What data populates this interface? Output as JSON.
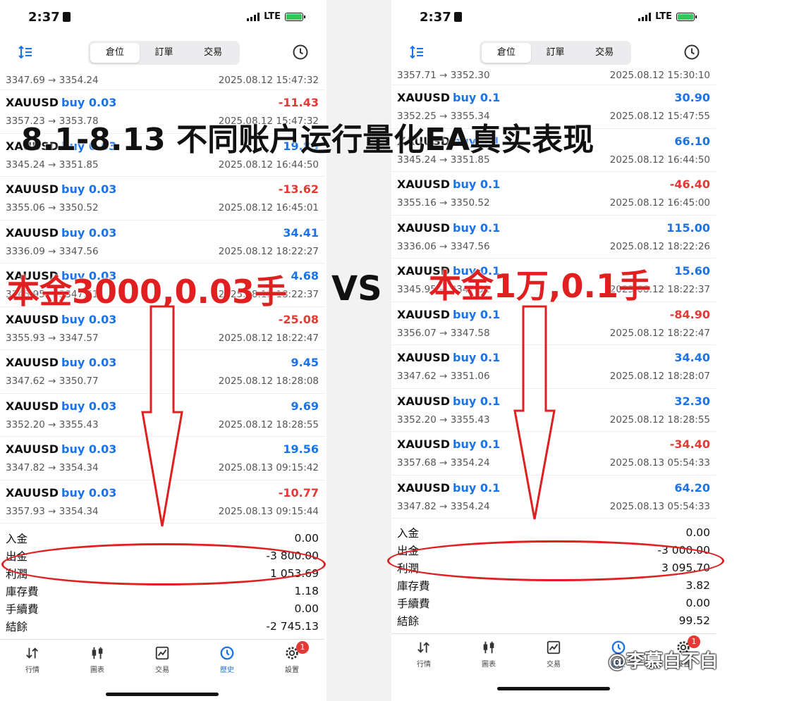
{
  "overlay": {
    "title": "8.1-8.13 不同账户运行量化EA真实表现",
    "left_label": "本金3000,0.03手",
    "vs": "VS",
    "right_label": "本金1万,0.1手",
    "watermark": "@李慕白不白"
  },
  "colors": {
    "accent_blue": "#1a73e8",
    "loss_red": "#e53935",
    "annotation_red": "#e02020",
    "battery_green": "#34c759"
  },
  "left": {
    "status_time": "2:37",
    "network": "LTE",
    "tabs": [
      "倉位",
      "訂單",
      "交易"
    ],
    "first_row": {
      "prices": "3347.69 → 3354.24",
      "date": "2025.08.12 15:47:32"
    },
    "trades": [
      {
        "symbol": "XAUUSD",
        "side": "buy 0.03",
        "profit": "-11.43",
        "prices": "3357.23 → 3353.78",
        "date": "2025.08.12 15:47:32"
      },
      {
        "symbol": "XAUUSD",
        "side": "buy 0.03",
        "profit": "19.83",
        "prices": "3345.24 → 3351.85",
        "date": "2025.08.12 16:44:50"
      },
      {
        "symbol": "XAUUSD",
        "side": "buy 0.03",
        "profit": "-13.62",
        "prices": "3355.06 → 3350.52",
        "date": "2025.08.12 16:45:01"
      },
      {
        "symbol": "XAUUSD",
        "side": "buy 0.03",
        "profit": "34.41",
        "prices": "3336.09 → 3347.56",
        "date": "2025.08.12 18:22:27"
      },
      {
        "symbol": "XAUUSD",
        "side": "buy 0.03",
        "profit": "4.68",
        "prices": "3345.95 → 3347.51",
        "date": "2025.08.12 18:22:37"
      },
      {
        "symbol": "XAUUSD",
        "side": "buy 0.03",
        "profit": "-25.08",
        "prices": "3355.93 → 3347.57",
        "date": "2025.08.12 18:22:47"
      },
      {
        "symbol": "XAUUSD",
        "side": "buy 0.03",
        "profit": "9.45",
        "prices": "3347.62 → 3350.77",
        "date": "2025.08.12 18:28:08"
      },
      {
        "symbol": "XAUUSD",
        "side": "buy 0.03",
        "profit": "9.69",
        "prices": "3352.20 → 3355.43",
        "date": "2025.08.12 18:28:55"
      },
      {
        "symbol": "XAUUSD",
        "side": "buy 0.03",
        "profit": "19.56",
        "prices": "3347.82 → 3354.34",
        "date": "2025.08.13 09:15:42"
      },
      {
        "symbol": "XAUUSD",
        "side": "buy 0.03",
        "profit": "-10.77",
        "prices": "3357.93 → 3354.34",
        "date": "2025.08.13 09:15:44"
      }
    ],
    "summary": [
      {
        "label": "入金",
        "value": "0.00"
      },
      {
        "label": "出金",
        "value": "-3 800.00"
      },
      {
        "label": "利潤",
        "value": "1 053.69"
      },
      {
        "label": "庫存費",
        "value": "1.18"
      },
      {
        "label": "手續費",
        "value": "0.00"
      },
      {
        "label": "結餘",
        "value": "-2 745.13"
      }
    ],
    "nav": [
      {
        "label": "行情",
        "icon": "trend-arrows-icon"
      },
      {
        "label": "圖表",
        "icon": "candlestick-icon"
      },
      {
        "label": "交易",
        "icon": "trade-chart-icon"
      },
      {
        "label": "歷史",
        "icon": "history-icon",
        "active": true
      },
      {
        "label": "設置",
        "icon": "gear-icon",
        "badge": "1"
      }
    ]
  },
  "right": {
    "status_time": "2:37",
    "network": "LTE",
    "tabs": [
      "倉位",
      "訂單",
      "交易"
    ],
    "first_row": {
      "prices": "3357.71 → 3352.30",
      "date": "2025.08.12 15:30:10"
    },
    "trades": [
      {
        "symbol": "XAUUSD",
        "side": "buy 0.1",
        "profit": "30.90",
        "prices": "3352.25 → 3355.34",
        "date": "2025.08.12 15:47:55"
      },
      {
        "symbol": "XAUUSD",
        "side": "buy 0.1",
        "profit": "66.10",
        "prices": "3345.24 → 3351.85",
        "date": "2025.08.12 16:44:50"
      },
      {
        "symbol": "XAUUSD",
        "side": "buy 0.1",
        "profit": "-46.40",
        "prices": "3355.16 → 3350.52",
        "date": "2025.08.12 16:45:00"
      },
      {
        "symbol": "XAUUSD",
        "side": "buy 0.1",
        "profit": "115.00",
        "prices": "3336.06 → 3347.56",
        "date": "2025.08.12 18:22:26"
      },
      {
        "symbol": "XAUUSD",
        "side": "buy 0.1",
        "profit": "15.60",
        "prices": "3345.95 → 3347.51",
        "date": "2025.08.12 18:22:37"
      },
      {
        "symbol": "XAUUSD",
        "side": "buy 0.1",
        "profit": "-84.90",
        "prices": "3356.07 → 3347.58",
        "date": "2025.08.12 18:22:47"
      },
      {
        "symbol": "XAUUSD",
        "side": "buy 0.1",
        "profit": "34.40",
        "prices": "3347.62 → 3351.06",
        "date": "2025.08.12 18:28:07"
      },
      {
        "symbol": "XAUUSD",
        "side": "buy 0.1",
        "profit": "32.30",
        "prices": "3352.20 → 3355.43",
        "date": "2025.08.12 18:28:55"
      },
      {
        "symbol": "XAUUSD",
        "side": "buy 0.1",
        "profit": "-34.40",
        "prices": "3357.68 → 3354.24",
        "date": "2025.08.13 05:54:33"
      },
      {
        "symbol": "XAUUSD",
        "side": "buy 0.1",
        "profit": "64.20",
        "prices": "3347.82 → 3354.24",
        "date": "2025.08.13 05:54:33"
      }
    ],
    "summary": [
      {
        "label": "入金",
        "value": "0.00"
      },
      {
        "label": "出金",
        "value": "-3 000.00"
      },
      {
        "label": "利潤",
        "value": "3 095.70"
      },
      {
        "label": "庫存費",
        "value": "3.82"
      },
      {
        "label": "手續費",
        "value": "0.00"
      },
      {
        "label": "結餘",
        "value": "99.52"
      }
    ],
    "nav": [
      {
        "label": "行情",
        "icon": "trend-arrows-icon"
      },
      {
        "label": "圖表",
        "icon": "candlestick-icon"
      },
      {
        "label": "交易",
        "icon": "trade-chart-icon"
      },
      {
        "label": "歷史",
        "icon": "history-icon",
        "active": true
      },
      {
        "label": "設置",
        "icon": "gear-icon",
        "badge": "1"
      }
    ]
  }
}
